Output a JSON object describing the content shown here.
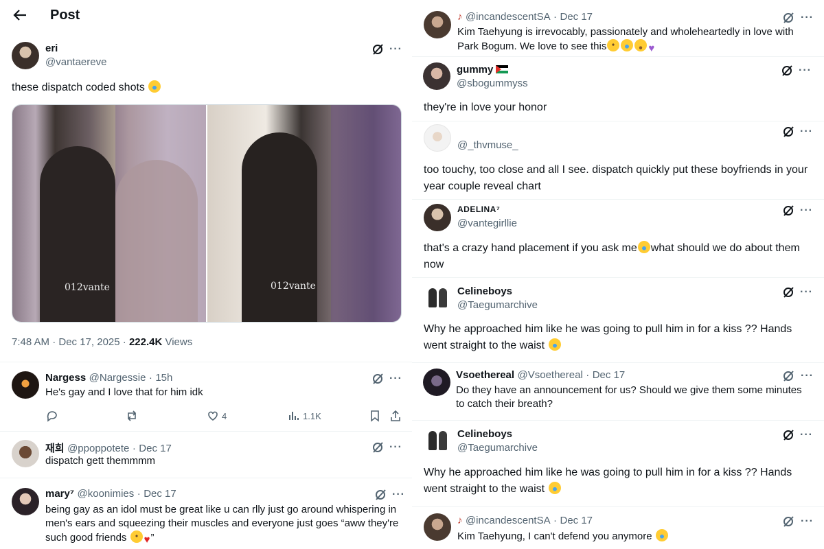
{
  "header": {
    "title": "Post"
  },
  "post": {
    "name": "eri",
    "handle": "@vantaereve",
    "text": "these dispatch coded shots",
    "watermark": "012vante",
    "time": "7:48 AM · Dec 17, 2025 · ",
    "views_count": "222.4K",
    "views_label": " Views"
  },
  "left_replies": [
    {
      "name": "Nargess",
      "handle": "@Nargessie",
      "date": "15h",
      "text": "He's gay and I love that for him idk",
      "stats": {
        "likes": "4",
        "views": "1.1K"
      }
    },
    {
      "name": "재희",
      "handle": "@ppoppotete",
      "date": "Dec 17",
      "text": "dispatch gett themmmm"
    },
    {
      "name": "mary⁷",
      "handle": "@koonimies",
      "date": "Dec 17",
      "text": "being gay as an idol must be great like u can rlly just go around whispering in men's ears and squeezing their muscles and everyone just goes “aww they're such good friends"
    }
  ],
  "right_replies": [
    {
      "name": "",
      "handle": "@incandescentSA",
      "date": "Dec 17",
      "text": "Kim Taehyung is irrevocably, passionately and wholeheartedly in love with Park Bogum. We love to see this"
    },
    {
      "name": "gummy",
      "handle": "@sbogummyss",
      "text": "they're in love your honor"
    },
    {
      "name": "",
      "handle": "@_thvmuse_",
      "text": "too touchy, too close and all I see. dispatch quickly put these boyfriends in your year couple reveal chart"
    },
    {
      "name": "ADELINA⁷",
      "handle": "@vantegirllie",
      "text": "that's a crazy hand placement if you ask me",
      "text2": "what should we do about them now"
    },
    {
      "name": "Celineboys",
      "handle": "@Taegumarchive",
      "text": "Why he approached him like he was going to pull him in for a kiss ?? Hands went straight to the waist"
    },
    {
      "name": "Vsoethereal",
      "handle": "@Vsoethereal",
      "date": "Dec 17",
      "text": "Do they have an announcement for us? Should we give them some minutes to catch their breath?"
    },
    {
      "name": "Celineboys",
      "handle": "@Taegumarchive",
      "text": "Why he approached him like he was going to pull him in for a kiss ?? Hands went straight to the waist"
    },
    {
      "name": "",
      "handle": "@incandescentSA",
      "date": "Dec 17",
      "text": "Kim Taehyung, I can't defend you anymore"
    }
  ],
  "glyphs": {
    "dot": "·",
    "more": "···",
    "back": "←",
    "heart": "♥"
  },
  "colors": {
    "muted": "#536471",
    "text": "#0f1419",
    "divider": "#eff3f4"
  }
}
